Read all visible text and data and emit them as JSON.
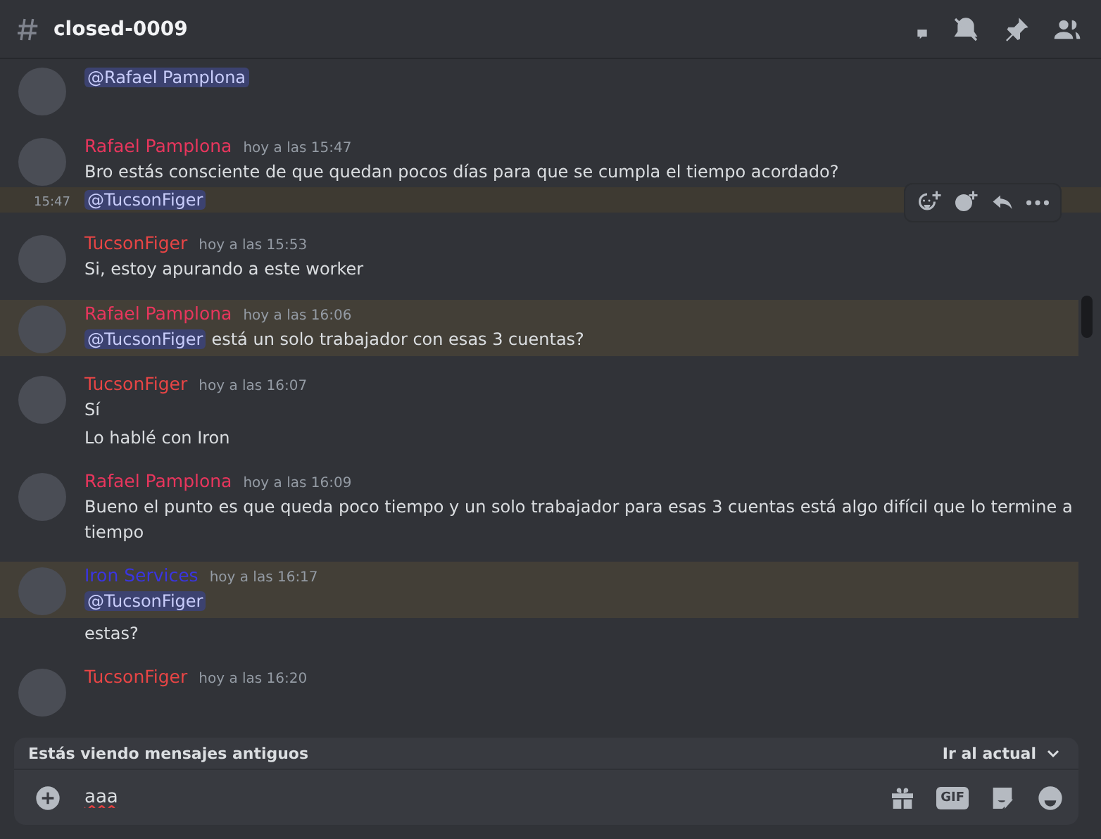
{
  "channel": {
    "name": "closed-0009"
  },
  "messages": [
    {
      "avatar": true,
      "highlighted": false,
      "toolbar": false,
      "lines": [
        {
          "mention": "@Rafael Pamplona",
          "hovered": false
        }
      ]
    },
    {
      "author": "Rafael Pamplona",
      "color": "#e8365d",
      "time": "hoy a las 15:47",
      "avatar": true,
      "highlighted": false,
      "toolbar": true,
      "lines": [
        {
          "text": "Bro estás consciente de que quedan pocos días para que se cumpla el tiempo acordado?",
          "hovered": false
        },
        {
          "mention": "@TucsonFiger",
          "hovered": true,
          "hover_time": "15:47"
        }
      ]
    },
    {
      "author": "TucsonFiger",
      "color": "#e84545",
      "time": "hoy a las 15:53",
      "avatar": true,
      "highlighted": false,
      "toolbar": false,
      "lines": [
        {
          "text": "Si, estoy apurando a este worker",
          "hovered": false
        }
      ]
    },
    {
      "author": "Rafael Pamplona",
      "color": "#e8365d",
      "time": "hoy a las 16:06",
      "avatar": true,
      "highlighted": true,
      "toolbar": false,
      "lines": [
        {
          "mention": "@TucsonFiger",
          "text": "está un solo trabajador con esas 3 cuentas?",
          "hovered": false
        }
      ]
    },
    {
      "author": "TucsonFiger",
      "color": "#e84545",
      "time": "hoy a las 16:07",
      "avatar": true,
      "highlighted": false,
      "toolbar": false,
      "lines": [
        {
          "text": "Sí",
          "hovered": false
        },
        {
          "text": "Lo hablé con Iron",
          "hovered": false
        }
      ]
    },
    {
      "author": "Rafael Pamplona",
      "color": "#e8365d",
      "time": "hoy a las 16:09",
      "avatar": true,
      "highlighted": false,
      "toolbar": false,
      "lines": [
        {
          "text": "Bueno el punto es que queda poco tiempo y un solo trabajador para esas 3 cuentas está algo difícil que lo termine a tiempo",
          "hovered": false
        }
      ]
    },
    {
      "author": "Iron Services",
      "color": "#3a35e0",
      "time": "hoy a las 16:17",
      "avatar": true,
      "highlighted": true,
      "toolbar": false,
      "lines": [
        {
          "mention": "@TucsonFiger",
          "hovered": false
        }
      ]
    },
    {
      "avatar": false,
      "highlighted": false,
      "toolbar": false,
      "lines": [
        {
          "text": "estas?",
          "hovered": false
        }
      ]
    },
    {
      "author": "TucsonFiger",
      "color": "#e84545",
      "time": "hoy a las 16:20",
      "avatar": true,
      "highlighted": false,
      "toolbar": false
    }
  ],
  "old_messages_bar": {
    "text": "Estás viendo mensajes antiguos",
    "action": "Ir al actual"
  },
  "composer": {
    "value": "aaa",
    "gif": "GIF"
  }
}
